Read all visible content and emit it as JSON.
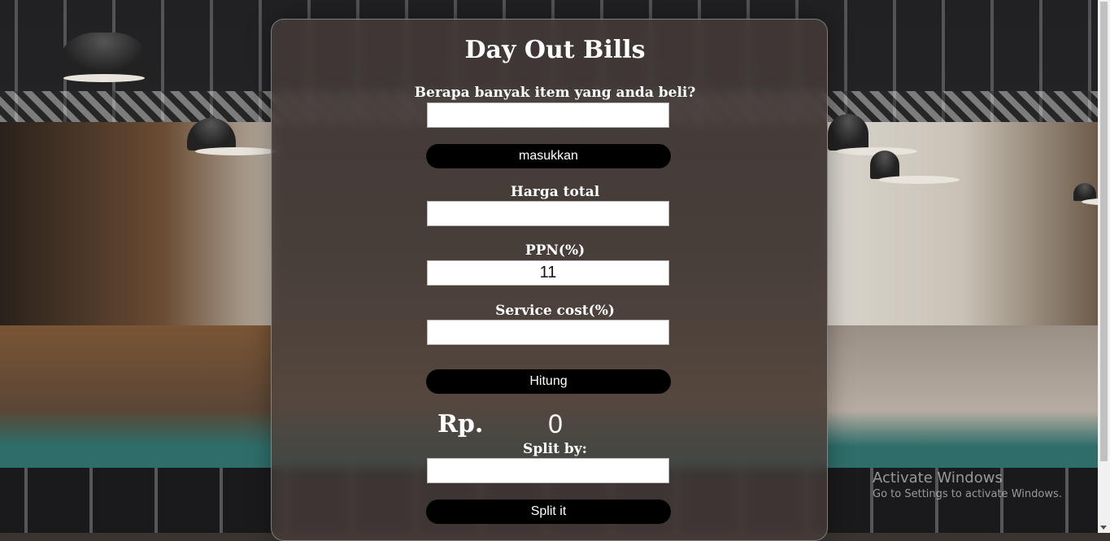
{
  "app": {
    "title": "Day Out Bills"
  },
  "items": {
    "label": "Berapa banyak item yang anda beli?",
    "value": "",
    "button_label": "masukkan"
  },
  "total_price": {
    "label": "Harga total",
    "value": ""
  },
  "ppn": {
    "label": "PPN(%)",
    "value": "11"
  },
  "service": {
    "label": "Service cost(%)",
    "value": ""
  },
  "calculate": {
    "button_label": "Hitung"
  },
  "result": {
    "currency": "Rp.",
    "value": "0"
  },
  "split": {
    "label": "Split by:",
    "value": "",
    "button_label": "Split it"
  },
  "windows_watermark": {
    "line1": "Activate Windows",
    "line2": "Go to Settings to activate Windows."
  },
  "colors": {
    "button_bg": "#000000",
    "text": "#ffffff",
    "card_bg": "rgba(70,62,58,0.78)"
  }
}
